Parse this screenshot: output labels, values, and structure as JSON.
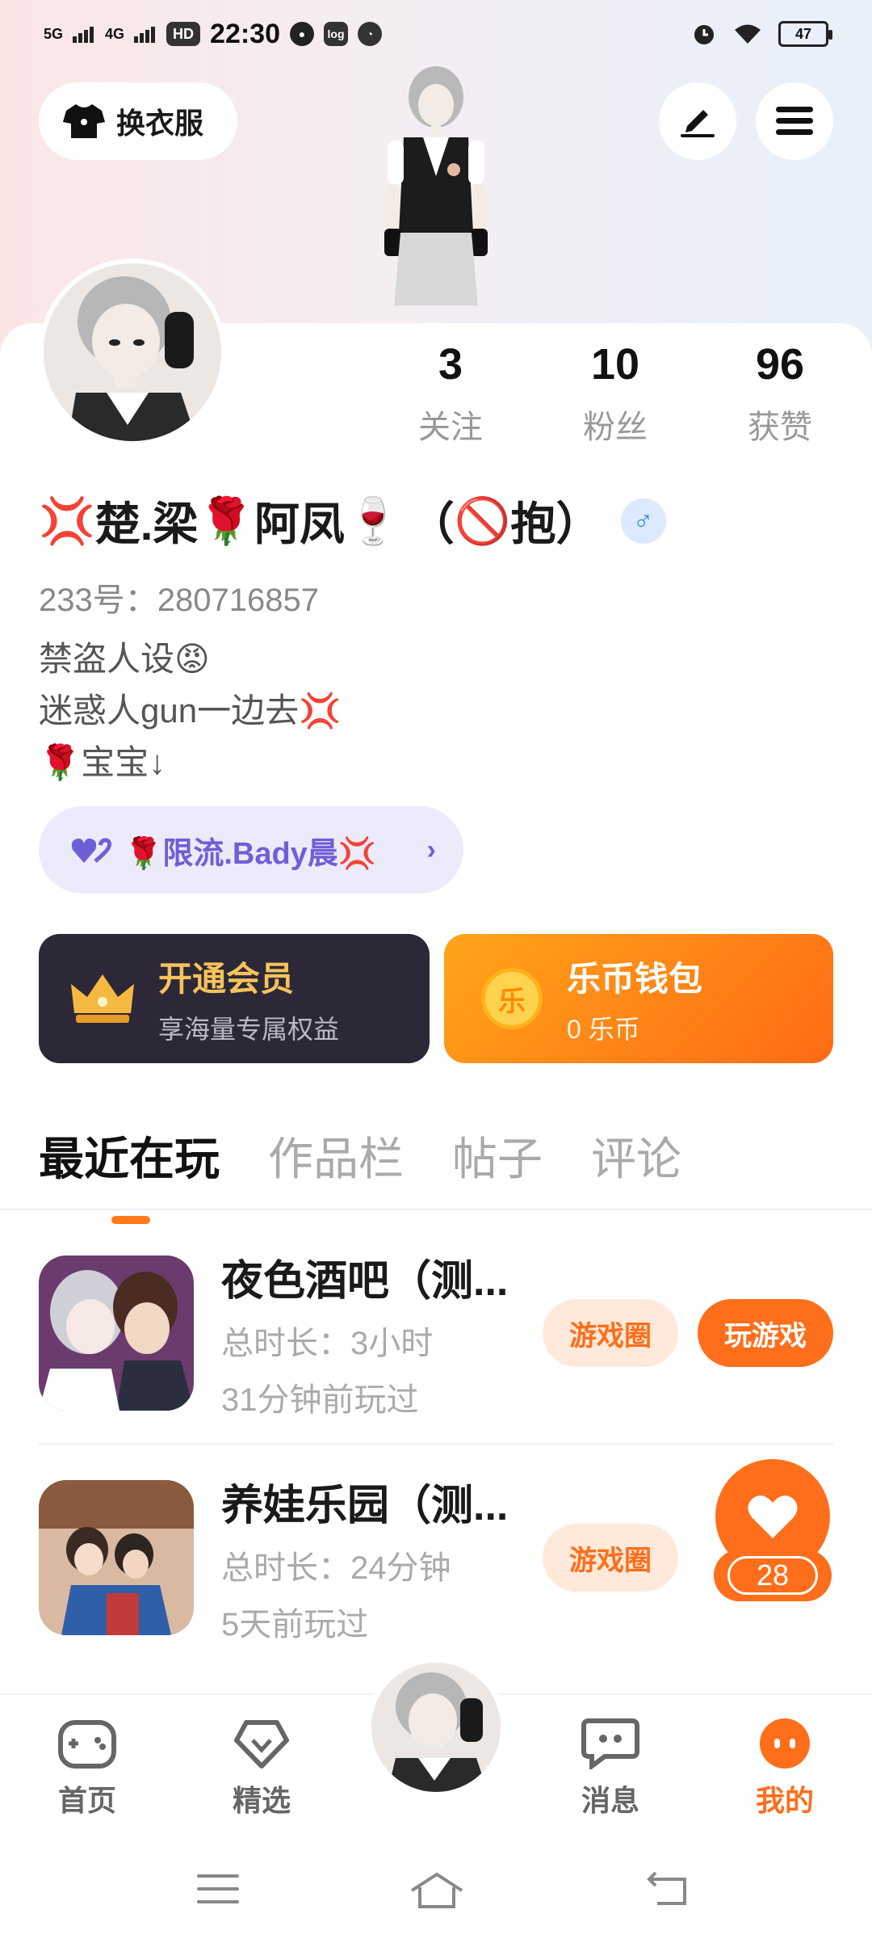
{
  "status_bar": {
    "network1": "5G",
    "network2": "4G",
    "hd": "HD",
    "time": "22:30",
    "battery": "47"
  },
  "header": {
    "dressup_label": "换衣服",
    "edit_icon": "pen-icon",
    "menu_icon": "menu-icon"
  },
  "profile": {
    "stats": [
      {
        "num": "3",
        "label": "关注"
      },
      {
        "num": "10",
        "label": "粉丝"
      },
      {
        "num": "96",
        "label": "获赞"
      }
    ],
    "nickname_prefix": "💢",
    "nickname_part1": "楚.梁",
    "nickname_rose": "🌹",
    "nickname_part2": "阿凤",
    "nickname_wine": "🍷",
    "nickname_suffix_open": "（",
    "nickname_no": "🚫",
    "nickname_suffix": "抱）",
    "gender": "♂",
    "uid_label": "233号：",
    "uid_value": "280716857",
    "bio_line1": "禁盗人设😡",
    "bio_line2": "迷惑人gun一边去💢",
    "bio_line3": "🌹宝宝↓"
  },
  "cp": {
    "label": "🌹限流.Bady晨💢",
    "icon": "double-heart-icon"
  },
  "member": {
    "title": "开通会员",
    "subtitle": "享海量专属权益"
  },
  "wallet": {
    "title": "乐币钱包",
    "subtitle": "0 乐币",
    "coin_char": "乐"
  },
  "tabs": [
    "最近在玩",
    "作品栏",
    "帖子",
    "评论"
  ],
  "games": [
    {
      "title": "夜色酒吧（测...",
      "duration": "总时长：3小时",
      "last_played": "31分钟前玩过",
      "circle_btn": "游戏圈",
      "play_btn": "玩游戏"
    },
    {
      "title": "养娃乐园（测...",
      "duration": "总时长：24分钟",
      "last_played": "5天前玩过",
      "circle_btn": "游戏圈"
    }
  ],
  "heart_badge": "28",
  "bottom_nav": [
    {
      "label": "首页",
      "icon": "gamepad-icon"
    },
    {
      "label": "精选",
      "icon": "heart-tag-icon"
    },
    {
      "label": "消息",
      "icon": "chat-icon"
    },
    {
      "label": "我的",
      "icon": "face-icon"
    }
  ],
  "colors": {
    "accent": "#ff6e1a",
    "member_bg": "#2c2838",
    "member_gold": "#f5c35a",
    "cp_purple": "#6f5fd6"
  }
}
